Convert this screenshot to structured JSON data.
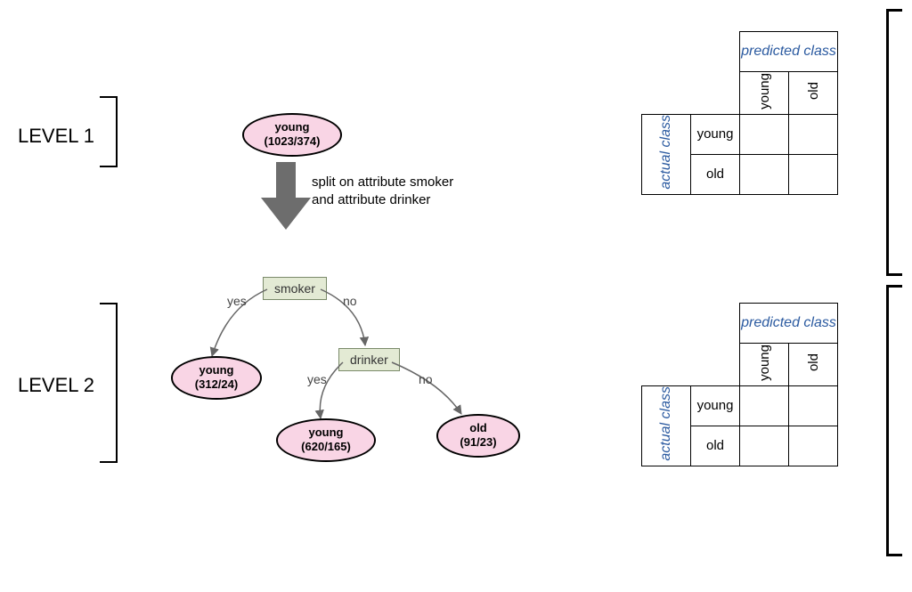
{
  "levels": {
    "l1": "LEVEL 1",
    "l2": "LEVEL 2"
  },
  "tree": {
    "root": {
      "label": "young",
      "stats": "(1023/374)"
    },
    "split_text_l1": "split on attribute smoker",
    "split_text_l2": "and attribute drinker",
    "smoker": {
      "label": "smoker"
    },
    "drinker": {
      "label": "drinker"
    },
    "edges": {
      "yes": "yes",
      "no": "no"
    },
    "leaf_smoker_yes": {
      "label": "young",
      "stats": "(312/24)"
    },
    "leaf_drinker_yes": {
      "label": "young",
      "stats": "(620/165)"
    },
    "leaf_drinker_no": {
      "label": "old",
      "stats": "(91/23)"
    }
  },
  "cm": {
    "predicted": "predicted class",
    "actual": "actual class",
    "cols": {
      "c1": "young",
      "c2": "old"
    },
    "rows": {
      "r1": "young",
      "r2": "old"
    }
  }
}
